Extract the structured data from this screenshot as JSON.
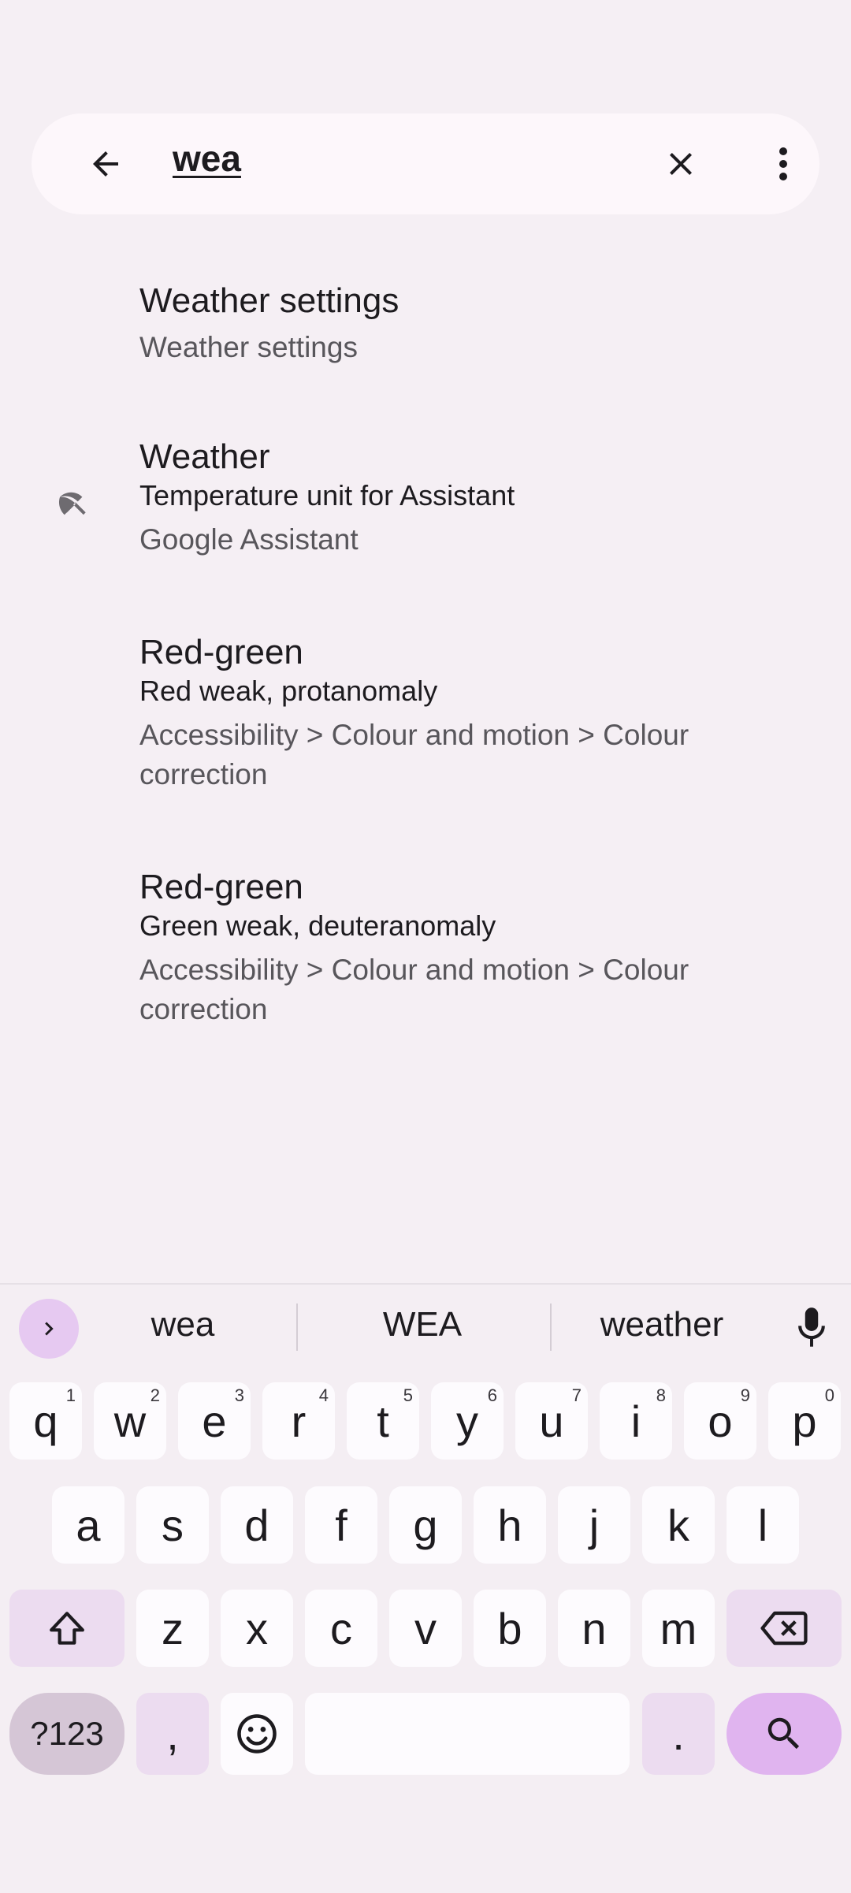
{
  "search": {
    "query": "wea",
    "back_icon": "arrow-back-icon",
    "clear_icon": "close-icon",
    "more_icon": "more-vert-icon"
  },
  "results": [
    {
      "title": "Weather settings",
      "subtitle": "",
      "path": "Weather settings",
      "icon": ""
    },
    {
      "title": "Weather",
      "subtitle": "Temperature unit for Assistant",
      "path": "Google Assistant",
      "icon": "weather-umbrella-icon"
    },
    {
      "title": "Red-green",
      "subtitle": "Red weak, protanomaly",
      "path": "Accessibility > Colour and motion > Colour correction",
      "icon": ""
    },
    {
      "title": "Red-green",
      "subtitle": "Green weak, deuteranomaly",
      "path": "Accessibility > Colour and motion > Colour correction",
      "icon": ""
    }
  ],
  "keyboard": {
    "suggestions": [
      "wea",
      "WEA",
      "weather"
    ],
    "row1": [
      {
        "k": "q",
        "h": "1"
      },
      {
        "k": "w",
        "h": "2"
      },
      {
        "k": "e",
        "h": "3"
      },
      {
        "k": "r",
        "h": "4"
      },
      {
        "k": "t",
        "h": "5"
      },
      {
        "k": "y",
        "h": "6"
      },
      {
        "k": "u",
        "h": "7"
      },
      {
        "k": "i",
        "h": "8"
      },
      {
        "k": "o",
        "h": "9"
      },
      {
        "k": "p",
        "h": "0"
      }
    ],
    "row2": [
      "a",
      "s",
      "d",
      "f",
      "g",
      "h",
      "j",
      "k",
      "l"
    ],
    "row3": [
      "z",
      "x",
      "c",
      "v",
      "b",
      "n",
      "m"
    ],
    "symbols_label": "?123",
    "comma_label": ",",
    "period_label": "."
  },
  "colors": {
    "background": "#f5eff4",
    "search_bar": "#fdf7fb",
    "accent_key": "#e0b4ef",
    "function_key": "#ecdcf0"
  }
}
